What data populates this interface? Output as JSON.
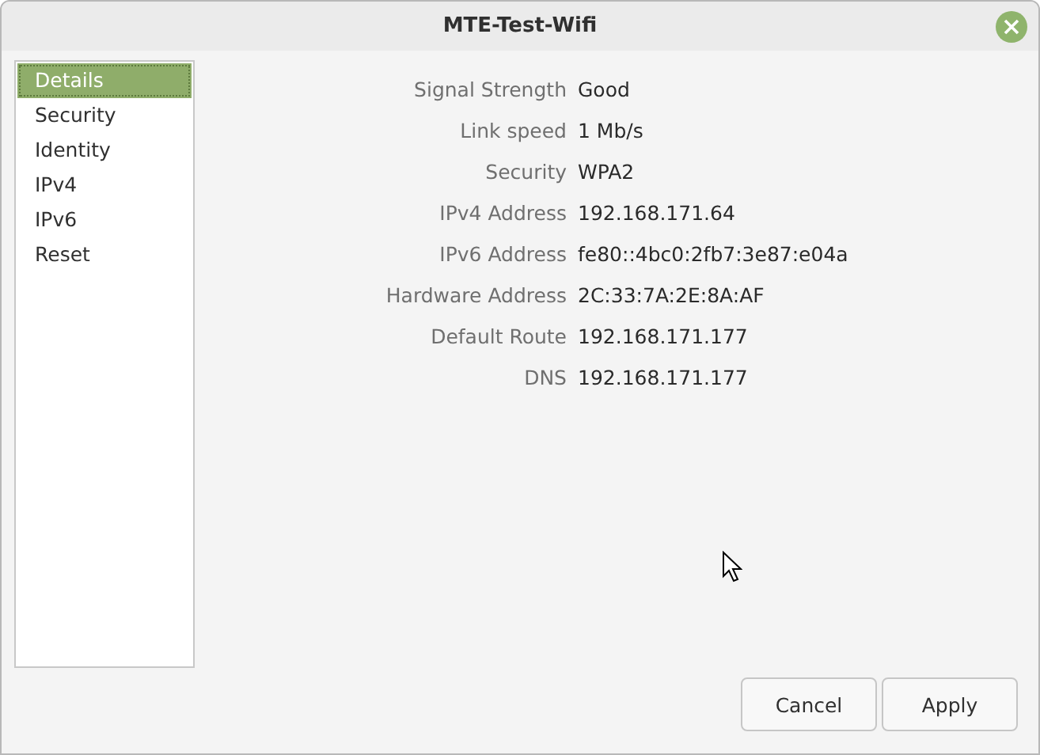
{
  "window": {
    "title": "MTE-Test-Wifi"
  },
  "sidebar": {
    "items": [
      {
        "label": "Details",
        "selected": true
      },
      {
        "label": "Security",
        "selected": false
      },
      {
        "label": "Identity",
        "selected": false
      },
      {
        "label": "IPv4",
        "selected": false
      },
      {
        "label": "IPv6",
        "selected": false
      },
      {
        "label": "Reset",
        "selected": false
      }
    ]
  },
  "details": [
    {
      "label": "Signal Strength",
      "value": "Good"
    },
    {
      "label": "Link speed",
      "value": "1 Mb/s"
    },
    {
      "label": "Security",
      "value": "WPA2"
    },
    {
      "label": "IPv4 Address",
      "value": "192.168.171.64"
    },
    {
      "label": "IPv6 Address",
      "value": "fe80::4bc0:2fb7:3e87:e04a"
    },
    {
      "label": "Hardware Address",
      "value": "2C:33:7A:2E:8A:AF"
    },
    {
      "label": "Default Route",
      "value": "192.168.171.177"
    },
    {
      "label": "DNS",
      "value": "192.168.171.177"
    }
  ],
  "buttons": [
    "Cancel",
    "Apply"
  ]
}
